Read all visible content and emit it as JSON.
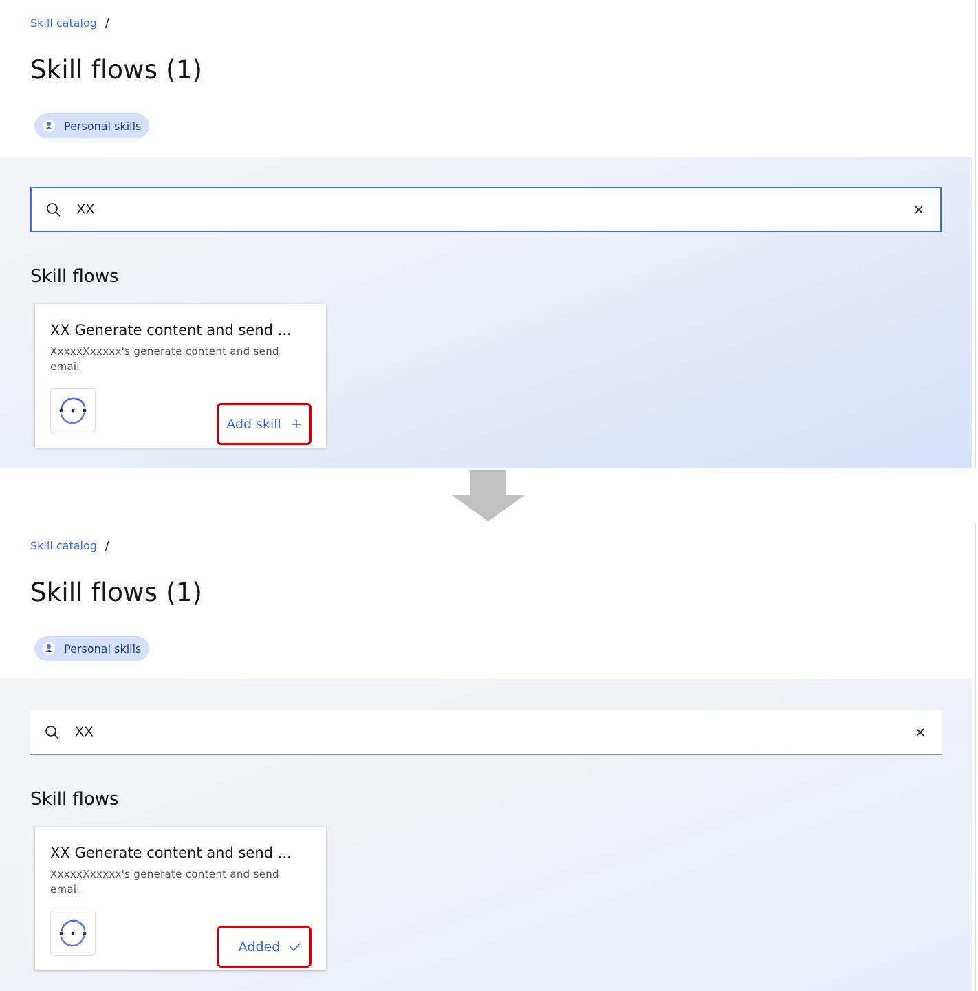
{
  "colors": {
    "accent": "#3b6fd6",
    "highlight_border": "#cc0000",
    "tag_background": "#d5e1fb",
    "arrow": "#c0c0c0"
  },
  "transition_arrow_icon": "arrow-down-icon",
  "before": {
    "breadcrumb": {
      "link": "Skill catalog",
      "separator": "/"
    },
    "page_title": "Skill flows (1)",
    "tag": {
      "icon": "person-icon",
      "label": "Personal skills"
    },
    "search": {
      "value": "XX",
      "icon": "search-icon",
      "clear_icon": "close-icon",
      "state": "focused"
    },
    "section_title": "Skill flows",
    "card": {
      "title": "XX Generate content and send ...",
      "description": "XxxxxXxxxxx's generate content and send email",
      "logo_icon": "skill-flow-logo-icon",
      "action": {
        "label": "Add skill",
        "icon": "plus-icon"
      }
    }
  },
  "after": {
    "breadcrumb": {
      "link": "Skill catalog",
      "separator": "/"
    },
    "page_title": "Skill flows (1)",
    "tag": {
      "icon": "person-icon",
      "label": "Personal skills"
    },
    "search": {
      "value": "XX",
      "icon": "search-icon",
      "clear_icon": "close-icon",
      "state": "unfocused"
    },
    "section_title": "Skill flows",
    "card": {
      "title": "XX Generate content and send ...",
      "description": "XxxxxXxxxxx's generate content and send email",
      "logo_icon": "skill-flow-logo-icon",
      "action": {
        "label": "Added",
        "icon": "checkmark-icon"
      }
    }
  }
}
